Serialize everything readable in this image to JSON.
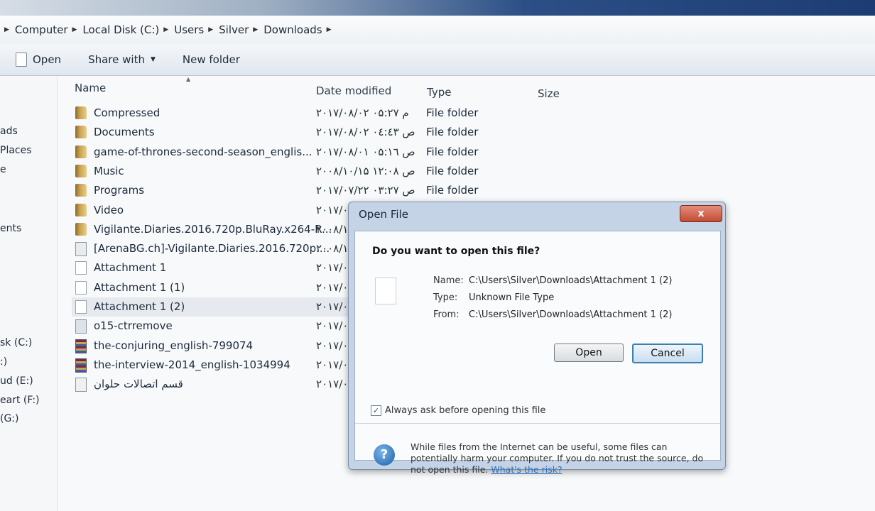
{
  "breadcrumb": {
    "items": [
      "Computer",
      "Local Disk (C:)",
      "Users",
      "Silver",
      "Downloads"
    ]
  },
  "toolbar": {
    "open_label": "Open",
    "share_label": "Share with",
    "new_folder_label": "New folder"
  },
  "nav_pane": {
    "items": [
      "ads",
      "Places",
      "e",
      "ents",
      "sk (C:)",
      ":)",
      "ud (E:)",
      "eart (F:)",
      "(G:)"
    ]
  },
  "columns": {
    "name": "Name",
    "date": "Date modified",
    "type": "Type",
    "size": "Size"
  },
  "files": [
    {
      "name": "Compressed",
      "date": "۲۰۱۷/۰۸/۰۲ م ۰۵:۲۷",
      "type": "File folder",
      "icon": "folder-icon"
    },
    {
      "name": "Documents",
      "date": "۲۰۱۷/۰۸/۰۲ ص ۰٤:٤٣",
      "type": "File folder",
      "icon": "folder-icon"
    },
    {
      "name": "game-of-thrones-second-season_englis...",
      "date": "۲۰۱۷/۰۸/۰۱ ص ۰۵:۱٦",
      "type": "File folder",
      "icon": "folder-icon"
    },
    {
      "name": "Music",
      "date": "۲۰۰۸/۱۰/۱۵ ص ۱۲:۰۸",
      "type": "File folder",
      "icon": "folder-icon"
    },
    {
      "name": "Programs",
      "date": "۲۰۱۷/۰۷/۲۲ ص ۰۳:۲۷",
      "type": "File folder",
      "icon": "folder-icon"
    },
    {
      "name": "Video",
      "date": "۲۰۱۷/۰",
      "type": "",
      "icon": "folder-icon"
    },
    {
      "name": "Vigilante.Diaries.2016.720p.BluRay.x264-R...",
      "date": "۲۰۰۸/۱",
      "type": "",
      "icon": "folder-icon"
    },
    {
      "name": "[ArenaBG.ch]-Vigilante.Diaries.2016.720p....",
      "date": "۲۰۰۸/۱",
      "type": "",
      "icon": "torrent-icon"
    },
    {
      "name": "Attachment 1",
      "date": "۲۰۱۷/۰",
      "type": "",
      "icon": "file-icon"
    },
    {
      "name": "Attachment 1 (1)",
      "date": "۲۰۱۷/۰",
      "type": "",
      "icon": "file-icon"
    },
    {
      "name": "Attachment 1 (2)",
      "date": "۲۰۱۷/۰",
      "type": "",
      "icon": "file-icon"
    },
    {
      "name": "o15-ctrremove",
      "date": "۲۰۱۷/۰",
      "type": "",
      "icon": "exe-icon"
    },
    {
      "name": "the-conjuring_english-799074",
      "date": "۲۰۱۷/۰",
      "type": "",
      "icon": "rar-icon"
    },
    {
      "name": "the-interview-2014_english-1034994",
      "date": "۲۰۱۷/۰",
      "type": "",
      "icon": "rar-icon"
    },
    {
      "name": "قسم اتصالات حلوان",
      "date": "۲۰۱۷/۰",
      "type": "",
      "icon": "doc-icon"
    }
  ],
  "dialog": {
    "title": "Open File",
    "close_label": "x",
    "question": "Do you want to open this file?",
    "name_label": "Name:",
    "name_value": "C:\\Users\\Silver\\Downloads\\Attachment 1 (2)",
    "type_label": "Type:",
    "type_value": "Unknown File Type",
    "from_label": "From:",
    "from_value": "C:\\Users\\Silver\\Downloads\\Attachment 1 (2)",
    "open_button": "Open",
    "cancel_button": "Cancel",
    "checkbox_label": "Always ask before opening this file",
    "checkbox_checked": true,
    "warning_text": "While files from the Internet can be useful, some files can potentially harm your computer. If you do not trust the source, do not open this file.",
    "risk_link": "What's the risk?"
  }
}
